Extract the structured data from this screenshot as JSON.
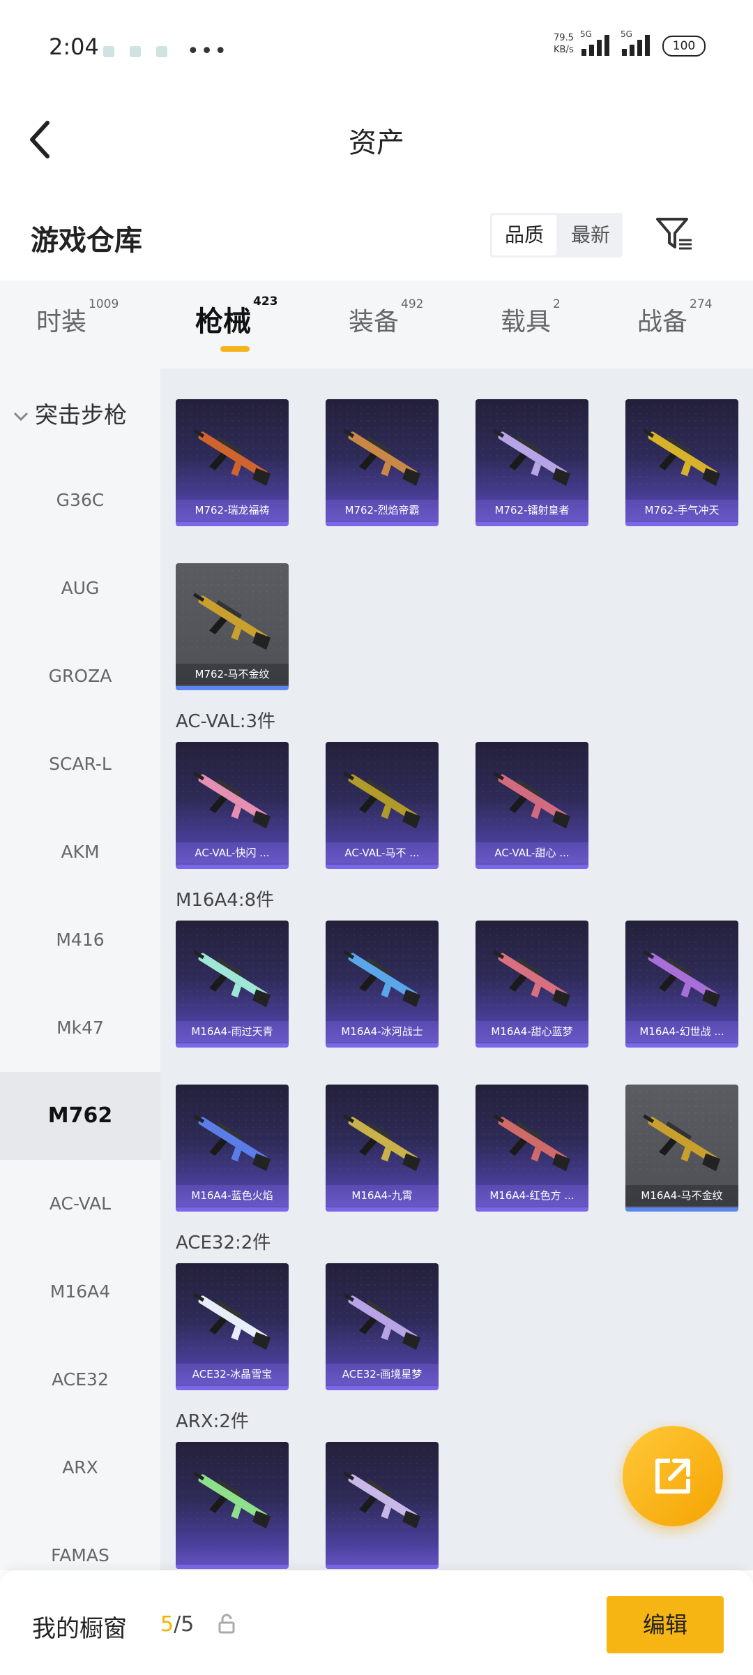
{
  "status_bar": {
    "time": "2:04",
    "net_rate": "79.5",
    "net_unit": "KB/s",
    "sim1": "5G",
    "sim2": "5G",
    "battery": "100"
  },
  "nav": {
    "title": "资产"
  },
  "warehouse": {
    "title": "游戏仓库",
    "sort_options": [
      "品质",
      "最新"
    ],
    "selected_sort": "品质"
  },
  "tabs": [
    {
      "label": "时装",
      "count": "1009"
    },
    {
      "label": "枪械",
      "count": "423",
      "active": true
    },
    {
      "label": "装备",
      "count": "492"
    },
    {
      "label": "载具",
      "count": "2"
    },
    {
      "label": "战备",
      "count": "274"
    }
  ],
  "sidebar": {
    "category": "突击步枪",
    "items": [
      "G36C",
      "AUG",
      "GROZA",
      "SCAR-L",
      "AKM",
      "M416",
      "Mk47",
      "M762",
      "AC-VAL",
      "M16A4",
      "ACE32",
      "ARX",
      "FAMAS"
    ],
    "selected": "M762"
  },
  "sections": [
    {
      "header": "",
      "items": [
        "M762-瑞龙福祷",
        "M762-烈焰帝霸",
        "M762-镭射皇者",
        "M762-手气冲天",
        "M762-马不金纹"
      ]
    },
    {
      "header": "AC-VAL:3件",
      "items": [
        "AC-VAL-快闪 ...",
        "AC-VAL-马不 ...",
        "AC-VAL-甜心 ..."
      ]
    },
    {
      "header": "M16A4:8件",
      "items": [
        "M16A4-雨过天青",
        "M16A4-冰河战士",
        "M16A4-甜心蓝梦",
        "M16A4-幻世战 ...",
        "M16A4-蓝色火焰",
        "M16A4-九霄",
        "M16A4-红色方 ...",
        "M16A4-马不金纹"
      ]
    },
    {
      "header": "ACE32:2件",
      "items": [
        "ACE32-冰晶雪宝",
        "ACE32-画境星梦"
      ]
    },
    {
      "header": "ARX:2件",
      "items": [
        "",
        ""
      ]
    }
  ],
  "icons": {
    "back": "back-arrow-icon",
    "filter": "filter-icon",
    "share": "share-icon",
    "lock": "lock-icon",
    "collapse": "chevron-down-icon"
  },
  "bottom_bar": {
    "label": "我的橱窗",
    "count_current": "5",
    "count_total": "/5",
    "edit_button": "编辑"
  },
  "colors": {
    "accent": "#f7b514",
    "card_purple": "#6656c4",
    "card_gray": "#55575d",
    "highlight_text": "#f5b300"
  }
}
